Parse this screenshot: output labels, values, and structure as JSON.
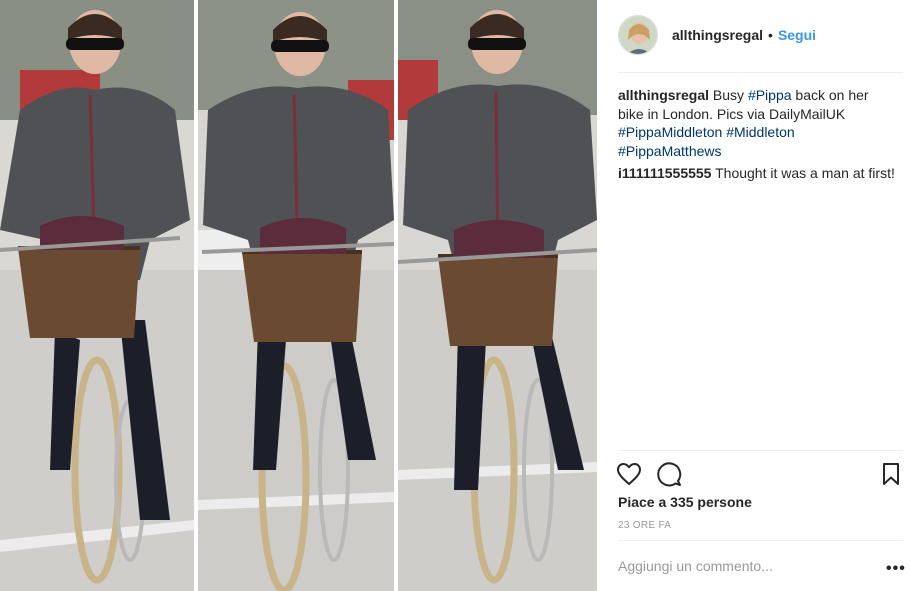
{
  "post": {
    "username": "allthingsregal",
    "separator": "•",
    "follow_label": "Segui"
  },
  "caption": {
    "user": "allthingsregal",
    "text_1": "Busy",
    "tag_pippa": "#Pippa",
    "text_2": "back on her bike in London. Pics via DailyMailUK",
    "tag_pippamiddleton": "#PippaMiddleton",
    "tag_middleton": "#Middleton",
    "tag_pippamatthews": "#PippaMatthews"
  },
  "comment": {
    "user": "i111111555555",
    "text": "Thought it was a man at first!"
  },
  "icons": {
    "like": "heart-icon",
    "comment": "comment-bubble-icon",
    "save": "bookmark-icon",
    "more": "more-options-icon"
  },
  "likes_label": "Piace a 335 persone",
  "timestamp": "23 ORE FA",
  "add_comment_placeholder": "Aggiungi un commento...",
  "more_label": "•••",
  "colors": {
    "link": "#3897f0",
    "hashtag": "#003569",
    "muted": "#999999",
    "text": "#262626"
  }
}
